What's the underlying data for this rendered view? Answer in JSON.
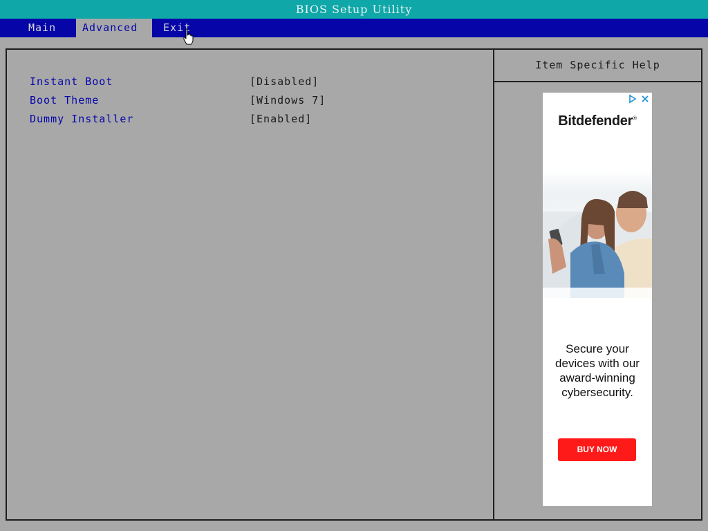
{
  "window": {
    "title": "BIOS Setup Utility"
  },
  "menu": {
    "items": [
      {
        "label": "Main",
        "active": false
      },
      {
        "label": "Advanced",
        "active": true
      },
      {
        "label": "Exit",
        "active": false
      }
    ]
  },
  "settings": [
    {
      "label": "Instant Boot",
      "value": "[Disabled]"
    },
    {
      "label": "Boot Theme",
      "value": "[Windows 7]"
    },
    {
      "label": "Dummy Installer",
      "value": "[Enabled]"
    }
  ],
  "help": {
    "title": "Item Specific Help"
  },
  "ad": {
    "brand": "Bitdefender",
    "text": "Secure your devices with our award-winning cybersecurity.",
    "cta": "BUY NOW",
    "colors": {
      "cta": "#ff1a1a",
      "adchoices": "#1e90d6"
    }
  },
  "colors": {
    "titlebar": "#0fa7a8",
    "menubar": "#0505a8",
    "background": "#a8a8a8",
    "label": "#0505a8",
    "border": "#1e1e1e"
  }
}
